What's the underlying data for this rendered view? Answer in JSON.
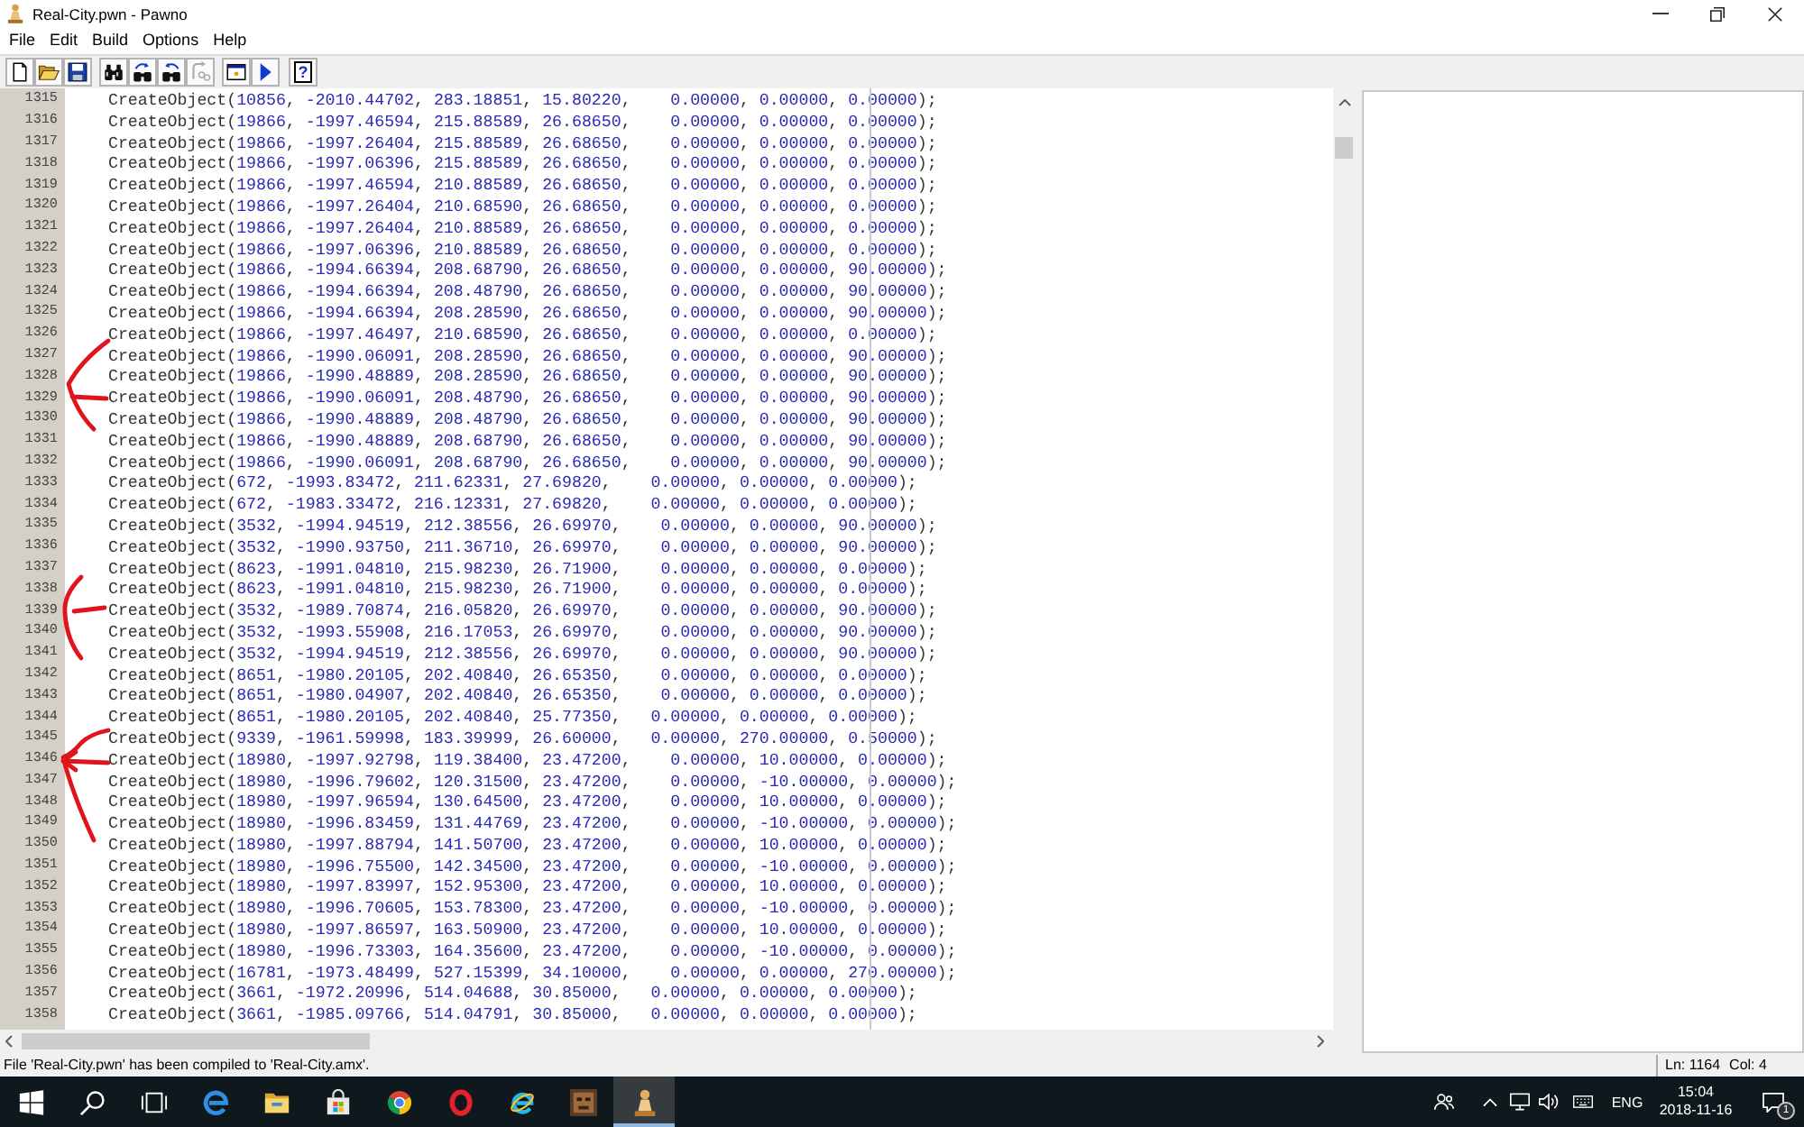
{
  "window": {
    "title": "Real-City.pwn - Pawno"
  },
  "menu": [
    "File",
    "Edit",
    "Build",
    "Options",
    "Help"
  ],
  "toolbar": {
    "groups": [
      {
        "buttons": [
          {
            "kind": "new",
            "disabled": false
          },
          {
            "kind": "open",
            "disabled": false
          },
          {
            "kind": "save",
            "disabled": false
          }
        ]
      },
      {
        "buttons": [
          {
            "kind": "find",
            "disabled": false
          },
          {
            "kind": "findnext",
            "disabled": false
          },
          {
            "kind": "replace",
            "disabled": false
          },
          {
            "kind": "goto",
            "disabled": true
          }
        ]
      },
      {
        "buttons": [
          {
            "kind": "window",
            "disabled": false
          },
          {
            "kind": "run",
            "disabled": false
          }
        ]
      },
      {
        "buttons": [
          {
            "kind": "help",
            "disabled": false,
            "label": "?"
          }
        ]
      }
    ]
  },
  "editor": {
    "lines": [
      {
        "number": "1315",
        "code": "CreateObject(10856, -2010.44702, 283.18851, 15.80220,    0.00000, 0.00000, 0.00000);"
      },
      {
        "number": "1316",
        "code": "CreateObject(19866, -1997.46594, 215.88589, 26.68650,    0.00000, 0.00000, 0.00000);"
      },
      {
        "number": "1317",
        "code": "CreateObject(19866, -1997.26404, 215.88589, 26.68650,    0.00000, 0.00000, 0.00000);"
      },
      {
        "number": "1318",
        "code": "CreateObject(19866, -1997.06396, 215.88589, 26.68650,    0.00000, 0.00000, 0.00000);"
      },
      {
        "number": "1319",
        "code": "CreateObject(19866, -1997.46594, 210.88589, 26.68650,    0.00000, 0.00000, 0.00000);"
      },
      {
        "number": "1320",
        "code": "CreateObject(19866, -1997.26404, 210.68590, 26.68650,    0.00000, 0.00000, 0.00000);"
      },
      {
        "number": "1321",
        "code": "CreateObject(19866, -1997.26404, 210.88589, 26.68650,    0.00000, 0.00000, 0.00000);"
      },
      {
        "number": "1322",
        "code": "CreateObject(19866, -1997.06396, 210.88589, 26.68650,    0.00000, 0.00000, 0.00000);"
      },
      {
        "number": "1323",
        "code": "CreateObject(19866, -1994.66394, 208.68790, 26.68650,    0.00000, 0.00000, 90.00000);"
      },
      {
        "number": "1324",
        "code": "CreateObject(19866, -1994.66394, 208.48790, 26.68650,    0.00000, 0.00000, 90.00000);"
      },
      {
        "number": "1325",
        "code": "CreateObject(19866, -1994.66394, 208.28590, 26.68650,    0.00000, 0.00000, 90.00000);"
      },
      {
        "number": "1326",
        "code": "CreateObject(19866, -1997.46497, 210.68590, 26.68650,    0.00000, 0.00000, 0.00000);"
      },
      {
        "number": "1327",
        "code": "CreateObject(19866, -1990.06091, 208.28590, 26.68650,    0.00000, 0.00000, 90.00000);"
      },
      {
        "number": "1328",
        "code": "CreateObject(19866, -1990.48889, 208.28590, 26.68650,    0.00000, 0.00000, 90.00000);"
      },
      {
        "number": "1329",
        "code": "CreateObject(19866, -1990.06091, 208.48790, 26.68650,    0.00000, 0.00000, 90.00000);"
      },
      {
        "number": "1330",
        "code": "CreateObject(19866, -1990.48889, 208.48790, 26.68650,    0.00000, 0.00000, 90.00000);"
      },
      {
        "number": "1331",
        "code": "CreateObject(19866, -1990.48889, 208.68790, 26.68650,    0.00000, 0.00000, 90.00000);"
      },
      {
        "number": "1332",
        "code": "CreateObject(19866, -1990.06091, 208.68790, 26.68650,    0.00000, 0.00000, 90.00000);"
      },
      {
        "number": "1333",
        "code": "CreateObject(672, -1993.83472, 211.62331, 27.69820,    0.00000, 0.00000, 0.00000);"
      },
      {
        "number": "1334",
        "code": "CreateObject(672, -1983.33472, 216.12331, 27.69820,    0.00000, 0.00000, 0.00000);"
      },
      {
        "number": "1335",
        "code": "CreateObject(3532, -1994.94519, 212.38556, 26.69970,    0.00000, 0.00000, 90.00000);"
      },
      {
        "number": "1336",
        "code": "CreateObject(3532, -1990.93750, 211.36710, 26.69970,    0.00000, 0.00000, 90.00000);"
      },
      {
        "number": "1337",
        "code": "CreateObject(8623, -1991.04810, 215.98230, 26.71900,    0.00000, 0.00000, 0.00000);"
      },
      {
        "number": "1338",
        "code": "CreateObject(8623, -1991.04810, 215.98230, 26.71900,    0.00000, 0.00000, 0.00000);"
      },
      {
        "number": "1339",
        "code": "CreateObject(3532, -1989.70874, 216.05820, 26.69970,    0.00000, 0.00000, 90.00000);"
      },
      {
        "number": "1340",
        "code": "CreateObject(3532, -1993.55908, 216.17053, 26.69970,    0.00000, 0.00000, 90.00000);"
      },
      {
        "number": "1341",
        "code": "CreateObject(3532, -1994.94519, 212.38556, 26.69970,    0.00000, 0.00000, 90.00000);"
      },
      {
        "number": "1342",
        "code": "CreateObject(8651, -1980.20105, 202.40840, 26.65350,    0.00000, 0.00000, 0.00000);"
      },
      {
        "number": "1343",
        "code": "CreateObject(8651, -1980.04907, 202.40840, 26.65350,    0.00000, 0.00000, 0.00000);"
      },
      {
        "number": "1344",
        "code": "CreateObject(8651, -1980.20105, 202.40840, 25.77350,   0.00000, 0.00000, 0.00000);"
      },
      {
        "number": "1345",
        "code": "CreateObject(9339, -1961.59998, 183.39999, 26.60000,   0.00000, 270.00000, 0.50000);"
      },
      {
        "number": "1346",
        "code": "CreateObject(18980, -1997.92798, 119.38400, 23.47200,    0.00000, 10.00000, 0.00000);"
      },
      {
        "number": "1347",
        "code": "CreateObject(18980, -1996.79602, 120.31500, 23.47200,    0.00000, -10.00000, 0.00000);"
      },
      {
        "number": "1348",
        "code": "CreateObject(18980, -1997.96594, 130.64500, 23.47200,    0.00000, 10.00000, 0.00000);"
      },
      {
        "number": "1349",
        "code": "CreateObject(18980, -1996.83459, 131.44769, 23.47200,    0.00000, -10.00000, 0.00000);"
      },
      {
        "number": "1350",
        "code": "CreateObject(18980, -1997.88794, 141.50700, 23.47200,    0.00000, 10.00000, 0.00000);"
      },
      {
        "number": "1351",
        "code": "CreateObject(18980, -1996.75500, 142.34500, 23.47200,    0.00000, -10.00000, 0.00000);"
      },
      {
        "number": "1352",
        "code": "CreateObject(18980, -1997.83997, 152.95300, 23.47200,    0.00000, 10.00000, 0.00000);"
      },
      {
        "number": "1353",
        "code": "CreateObject(18980, -1996.70605, 153.78300, 23.47200,    0.00000, -10.00000, 0.00000);"
      },
      {
        "number": "1354",
        "code": "CreateObject(18980, -1997.86597, 163.50900, 23.47200,    0.00000, 10.00000, 0.00000);"
      },
      {
        "number": "1355",
        "code": "CreateObject(18980, -1996.73303, 164.35600, 23.47200,    0.00000, -10.00000, 0.00000);"
      },
      {
        "number": "1356",
        "code": "CreateObject(16781, -1973.48499, 527.15399, 34.10000,    0.00000, 0.00000, 270.00000);"
      },
      {
        "number": "1357",
        "code": "CreateObject(3661, -1972.20996, 514.04688, 30.85000,   0.00000, 0.00000, 0.00000);"
      },
      {
        "number": "1358",
        "code": "CreateObject(3661, -1985.09766, 514.04791, 30.85000,   0.00000, 0.00000, 0.00000);"
      }
    ]
  },
  "status_bar": {
    "message": "File 'Real-City.pwn' has been compiled to 'Real-City.amx'.",
    "line": "Ln: 1164",
    "column": "Col: 4"
  },
  "taskbar": {
    "buttons": [
      {
        "kind": "start"
      },
      {
        "kind": "search"
      },
      {
        "kind": "taskview"
      }
    ],
    "apps": [
      {
        "kind": "edge",
        "selected": false
      },
      {
        "kind": "folder",
        "selected": false
      },
      {
        "kind": "store",
        "selected": false
      },
      {
        "kind": "chrome",
        "selected": false
      },
      {
        "kind": "opera",
        "selected": false
      },
      {
        "kind": "ie",
        "selected": false
      },
      {
        "kind": "game",
        "selected": false
      },
      {
        "kind": "pawno",
        "selected": true
      }
    ],
    "tray": {
      "language": "ENG",
      "time": "15:04",
      "date": "2018-11-16",
      "notifications": "1"
    }
  }
}
